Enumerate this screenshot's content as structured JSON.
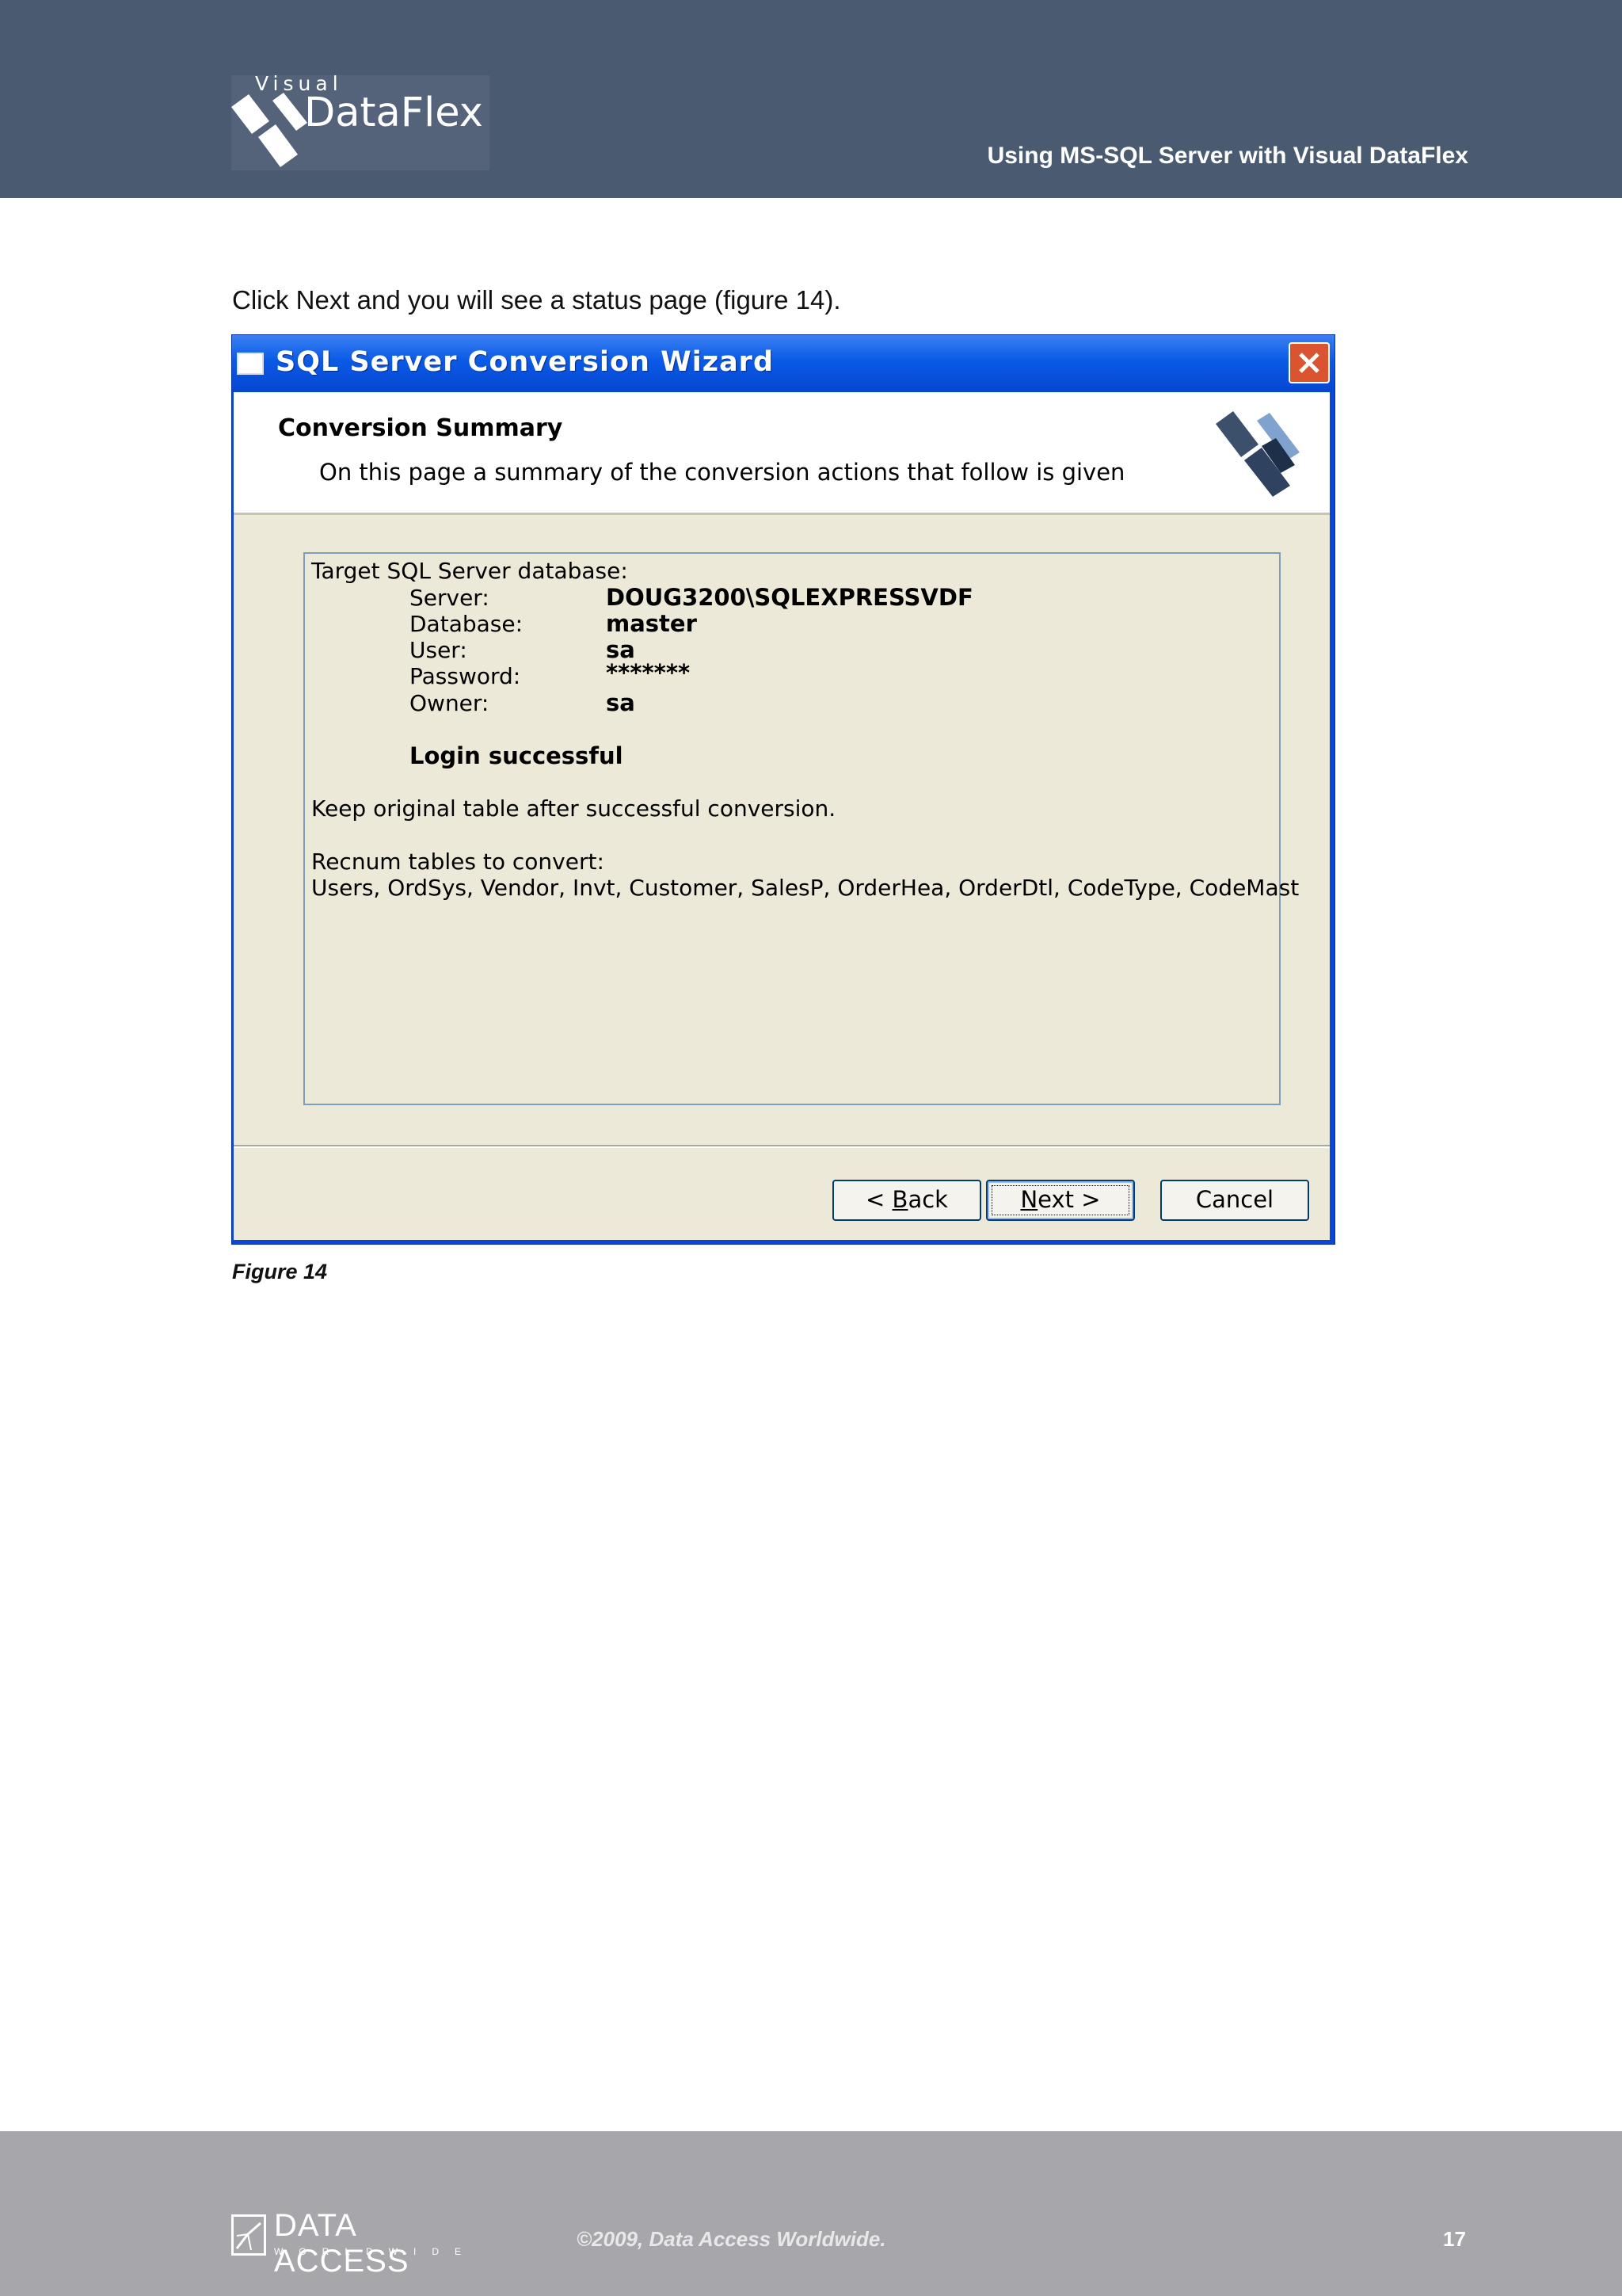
{
  "header": {
    "logo_small": "Visual",
    "logo_main": "DataFlex",
    "doc_title": "Using MS-SQL Server with Visual DataFlex"
  },
  "intro_text": "Click Next and you will see a status page (figure 14).",
  "wizard": {
    "window_title": "SQL Server Conversion Wizard",
    "banner_title": "Conversion Summary",
    "banner_subtitle": "On this page a summary of the conversion actions that follow is given",
    "summary": {
      "target_heading": "Target SQL Server database:",
      "server_label": "Server:",
      "server_value": "DOUG3200\\SQLEXPRESSVDF",
      "database_label": "Database:",
      "database_value": "master",
      "user_label": "User:",
      "user_value": "sa",
      "password_label": "Password:",
      "password_value": "*******",
      "owner_label": "Owner:",
      "owner_value": "sa",
      "login_status": "Login successful",
      "keep_original": "Keep original table after successful conversion.",
      "recnum_heading": "Recnum tables to convert:",
      "recnum_tables": "Users, OrdSys, Vendor, Invt, Customer, SalesP, OrderHea, OrderDtl, CodeType, CodeMast"
    },
    "buttons": {
      "back_prefix": "< ",
      "back_key": "B",
      "back_rest": "ack",
      "next_key": "N",
      "next_rest": "ext >",
      "cancel": "Cancel"
    }
  },
  "caption": "Figure 14",
  "footer": {
    "company_logo_text": "DATA ACCESS",
    "company_logo_sub": "WORLDWIDE",
    "copyright": "©2009, Data Access Worldwide.",
    "page_number": "17"
  },
  "colors": {
    "header_bg": "#4a5a71",
    "footer_bg": "#a7a6aa",
    "xp_titlebar": "#0a5ae6",
    "xp_dialog": "#ece9d8"
  }
}
